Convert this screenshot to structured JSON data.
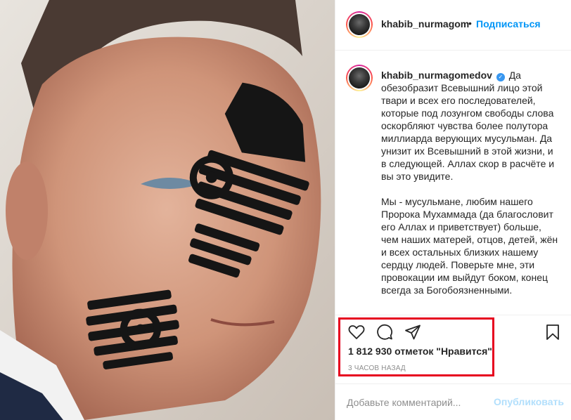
{
  "header": {
    "username": "khabib_nurmagom",
    "separator": "•",
    "follow_label": "Подписаться"
  },
  "caption": {
    "username": "khabib_nurmagomedov",
    "verified": true,
    "paragraph1": "Да обезобразит Всевышний лицо этой твари и всех его последователей, которые под лозунгом свободы слова оскорбляют чувства более полутора миллиарда верующих мусульман. Да унизит их Всевышний в этой жизни, и в следующей. Аллах скор в расчёте и вы это увидите.",
    "paragraph2": "Мы - мусульмане, любим нашего Пророка Мухаммада (да благословит его Аллах и приветствует) больше, чем наших матерей, отцов, детей, жён и всех остальных близких нашему сердцу людей. Поверьте мне, эти провокации им выйдут боком, конец всегда за Богобоязненными."
  },
  "actions": {
    "like_icon": "heart-icon",
    "comment_icon": "comment-bubble-icon",
    "share_icon": "paper-plane-icon",
    "save_icon": "bookmark-icon"
  },
  "stats": {
    "likes": "1 812 930 отметок \"Нравится\"",
    "time": "3 ЧАСОВ НАЗАД"
  },
  "comment": {
    "placeholder": "Добавьте комментарий...",
    "post_label": "Опубликовать"
  },
  "colors": {
    "accent": "#0095f6",
    "post_disabled": "#b2dffc",
    "highlight": "#e6001e",
    "verified": "#3897f0"
  }
}
